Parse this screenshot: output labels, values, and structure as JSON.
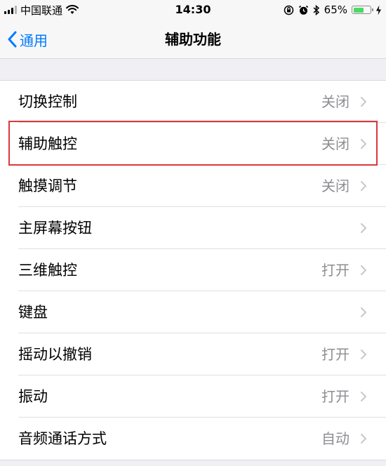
{
  "status_bar": {
    "carrier": "中国联通",
    "time": "14:30",
    "battery_percent": "65%",
    "battery_level": 0.65,
    "icons": [
      "signal-icon",
      "wifi-icon",
      "orientation-lock-icon",
      "alarm-icon",
      "bluetooth-icon",
      "battery-icon",
      "charging-icon"
    ]
  },
  "nav": {
    "back_label": "通用",
    "title": "辅助功能"
  },
  "colors": {
    "accent": "#007aff",
    "highlight": "#d9393c",
    "battery": "#4cd964",
    "secondary_text": "#8e8e93"
  },
  "list": {
    "items": [
      {
        "label": "切换控制",
        "value": "关闭"
      },
      {
        "label": "辅助触控",
        "value": "关闭"
      },
      {
        "label": "触摸调节",
        "value": "关闭"
      },
      {
        "label": "主屏幕按钮",
        "value": ""
      },
      {
        "label": "三维触控",
        "value": "打开"
      },
      {
        "label": "键盘",
        "value": ""
      },
      {
        "label": "摇动以撤销",
        "value": "打开"
      },
      {
        "label": "振动",
        "value": "打开"
      },
      {
        "label": "音频通话方式",
        "value": "自动"
      }
    ]
  }
}
